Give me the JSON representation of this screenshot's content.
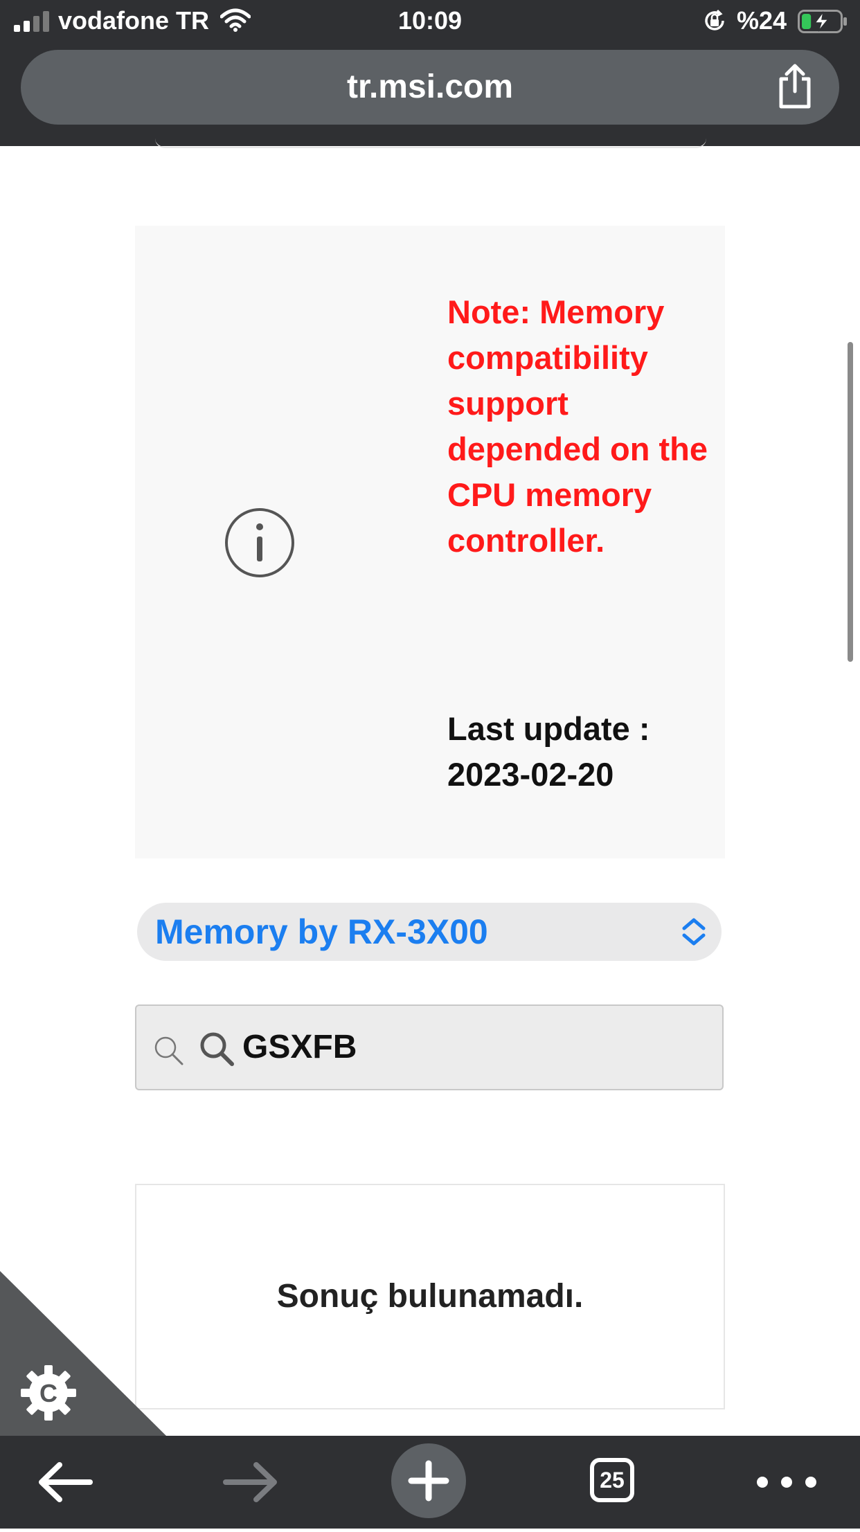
{
  "status_bar": {
    "carrier": "vodafone TR",
    "time": "10:09",
    "battery_percent": "%24",
    "battery_level": 0.24,
    "signal_bars": 2
  },
  "address_bar": {
    "url": "tr.msi.com"
  },
  "note_box": {
    "note_text": "Note: Memory compatibility support depended on the CPU memory controller.",
    "last_update_text": "Last update : 2023-02-20"
  },
  "memory_select": {
    "selected": "Memory by RX-3X00"
  },
  "search": {
    "value": "GSXFB"
  },
  "results": {
    "empty_message": "Sonuç bulunamadı."
  },
  "toolbar": {
    "tab_count": "25"
  },
  "colors": {
    "chrome_bg": "#2f3033",
    "url_pill": "#5d6165",
    "note_red": "#ff1a1a",
    "link_blue": "#1b7ef0",
    "battery_green": "#34c759"
  },
  "icons": {
    "signal": "signal-bars-icon",
    "wifi": "wifi-icon",
    "orientation_lock": "orientation-lock-icon",
    "battery": "battery-charging-icon",
    "share": "share-icon",
    "info": "info-circle-icon",
    "select_chevron": "chevron-up-down-icon",
    "search": "search-icon",
    "settings": "gear-icon",
    "back": "arrow-left-icon",
    "forward": "arrow-right-icon",
    "new_tab": "plus-icon",
    "tabs": "tabs-icon",
    "more": "more-horizontal-icon"
  }
}
